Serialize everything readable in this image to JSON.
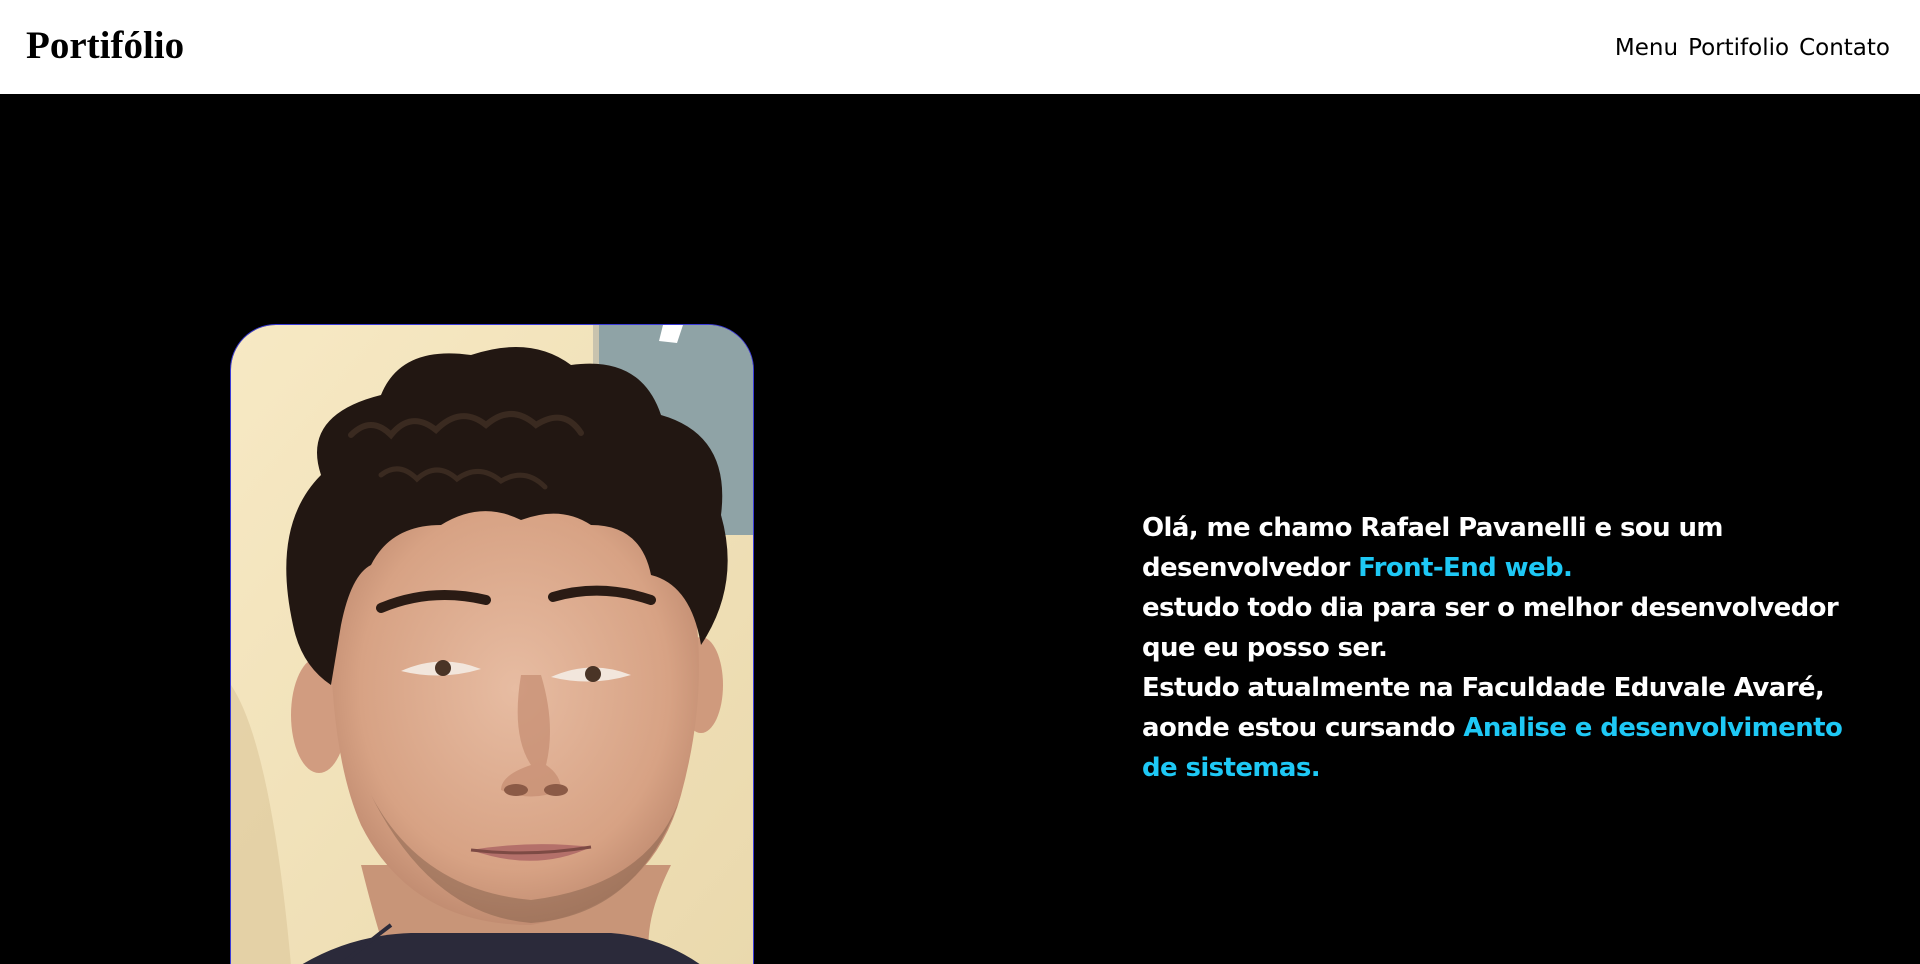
{
  "header": {
    "logo": "Portifólio",
    "nav": [
      {
        "label": "Menu"
      },
      {
        "label": "Portifolio"
      },
      {
        "label": "Contato"
      }
    ]
  },
  "hero": {
    "photo_icon": "profile-photo",
    "intro": {
      "line1_a": "Olá, me chamo Rafael Pavanelli e sou um",
      "line1_b": "desenvolvedor ",
      "highlight1": "Front-End web.",
      "line2": "estudo todo dia para ser o melhor desenvolvedor que eu posso ser.",
      "line3_a": "Estudo atualmente na Faculdade Eduvale Avaré, aonde estou cursando ",
      "highlight2": "Analise e desenvolvimento de sistemas."
    }
  },
  "colors": {
    "header_bg": "#ffffff",
    "hero_bg": "#000000",
    "accent": "#1ec8f5",
    "photo_border": "#3b3bd8"
  }
}
